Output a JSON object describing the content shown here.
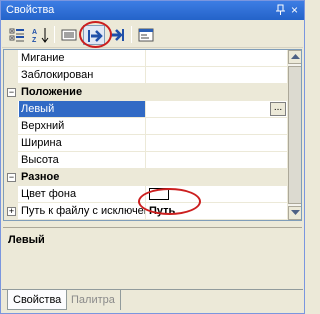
{
  "window": {
    "title": "Свойства",
    "close_label": "×"
  },
  "toolbar": {
    "buttons": [
      {
        "icon": "categorized-icon"
      },
      {
        "icon": "alphabetical-icon"
      },
      {
        "icon": "properties-icon"
      },
      {
        "icon": "events-arrow-icon"
      },
      {
        "icon": "events-arrow-alt-icon"
      },
      {
        "icon": "property-pages-icon"
      }
    ]
  },
  "grid": {
    "rows": [
      {
        "type": "prop",
        "name": "Мигание",
        "value": ""
      },
      {
        "type": "prop",
        "name": "Заблокирован",
        "value": ""
      },
      {
        "type": "category",
        "name": "Положение",
        "toggle": "−"
      },
      {
        "type": "prop",
        "name": "Левый",
        "value": "",
        "selected": true,
        "ellipsis": "..."
      },
      {
        "type": "prop",
        "name": "Верхний",
        "value": ""
      },
      {
        "type": "prop",
        "name": "Ширина",
        "value": ""
      },
      {
        "type": "prop",
        "name": "Высота",
        "value": ""
      },
      {
        "type": "category",
        "name": "Разное",
        "toggle": "−"
      },
      {
        "type": "prop",
        "name": "Цвет фона",
        "value": "",
        "swatch": "#ffffff"
      },
      {
        "type": "prop",
        "name": "Путь к файлу с исключени",
        "value": "Путь",
        "toggle": "+"
      }
    ]
  },
  "description": {
    "title": "Левый"
  },
  "tabs": [
    {
      "label": "Свойства",
      "active": true
    },
    {
      "label": "Палитра",
      "active": false
    }
  ],
  "colors": {
    "titlebar": "#2463c9",
    "selection": "#316ac5",
    "annotation": "#cc1f1f"
  }
}
